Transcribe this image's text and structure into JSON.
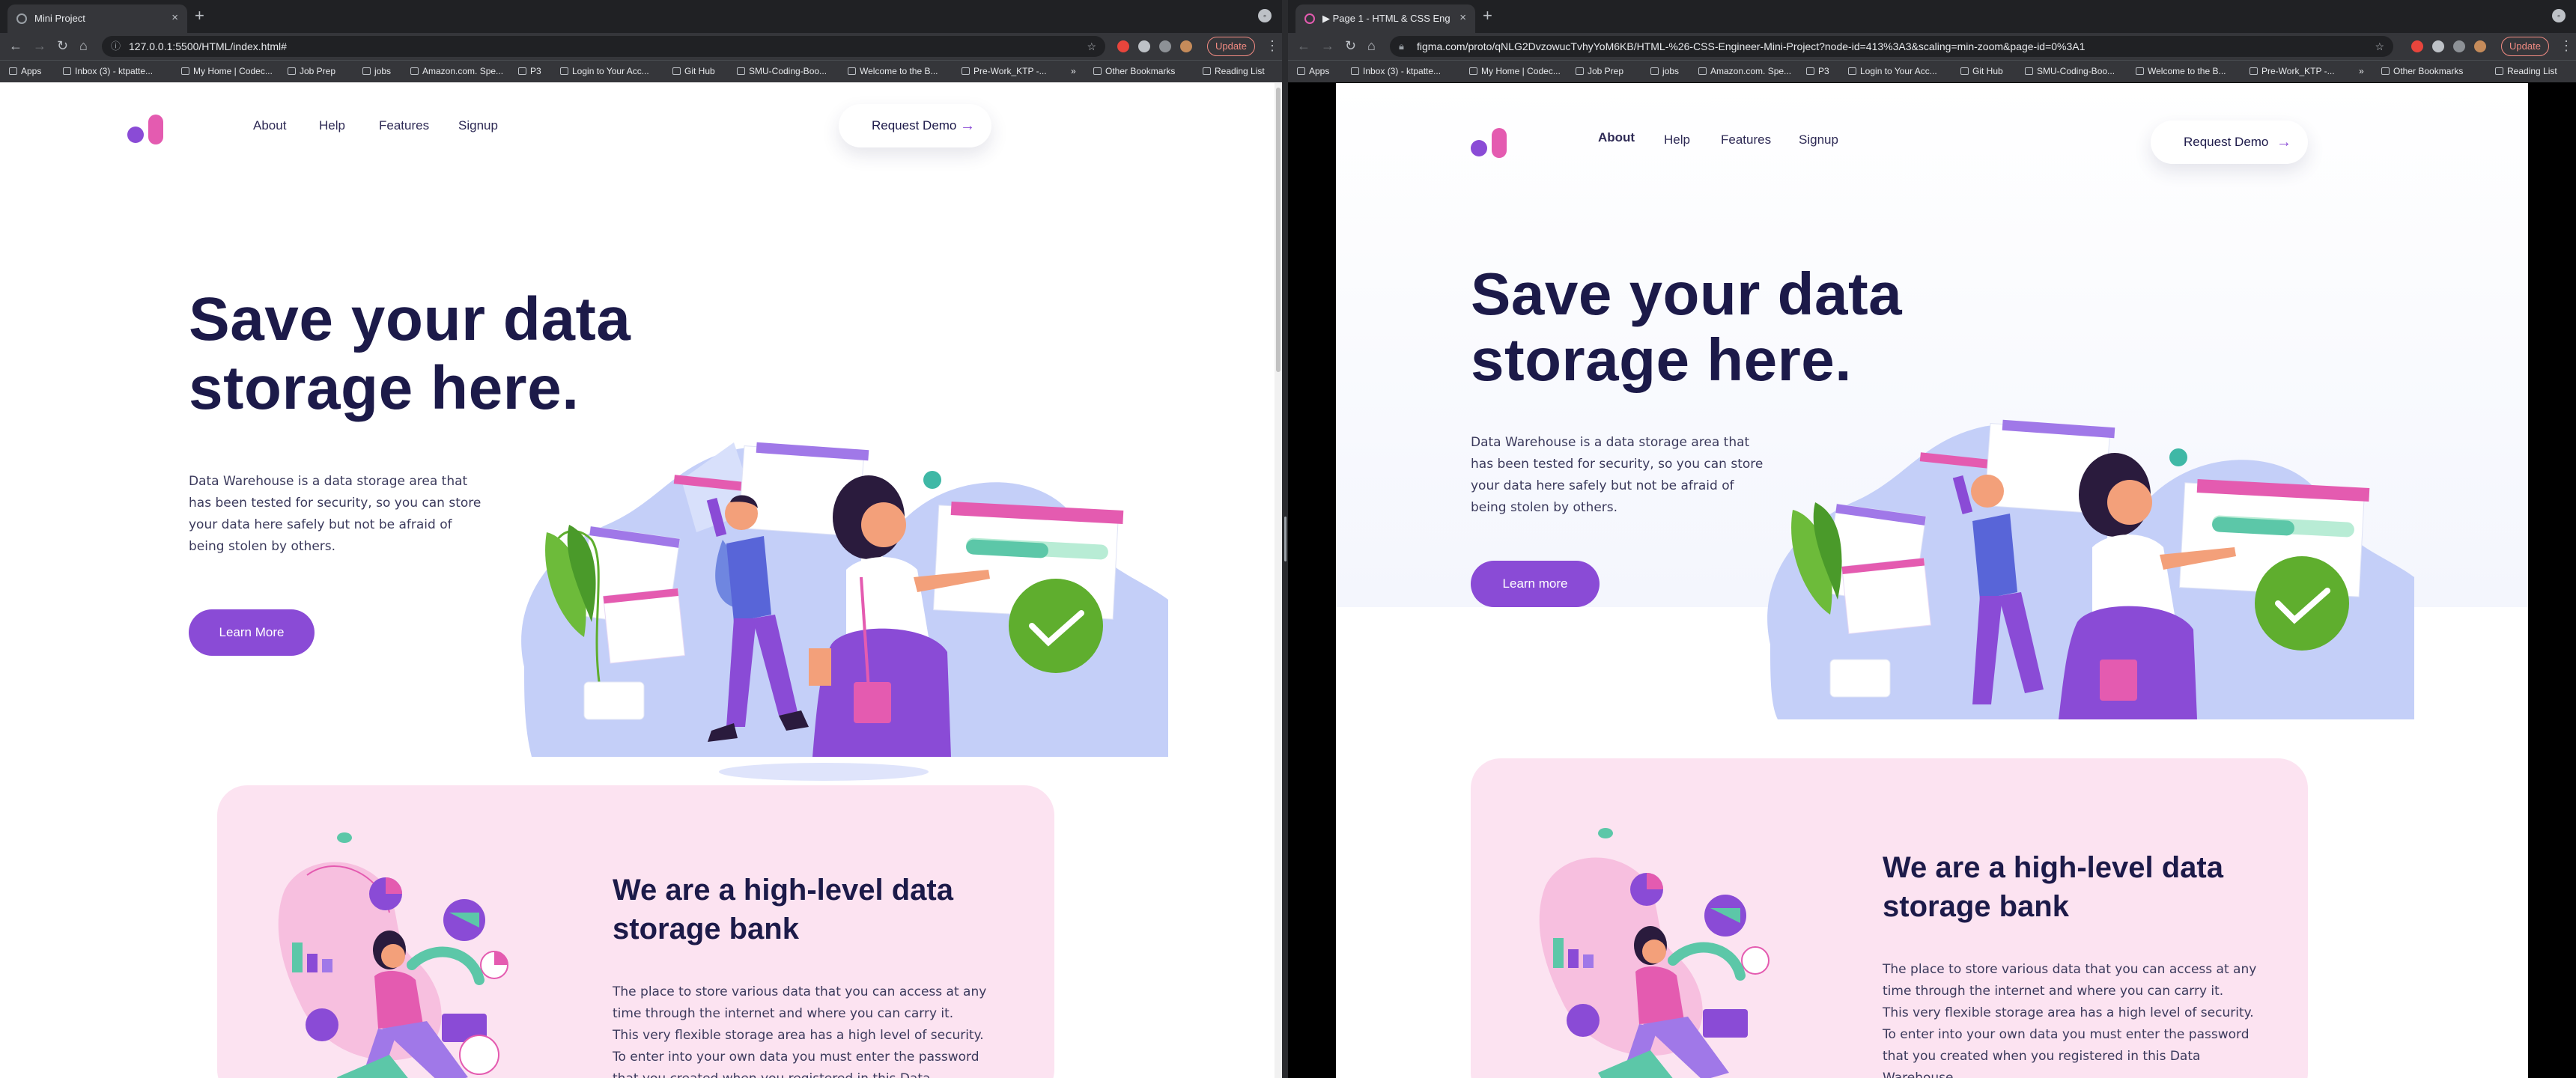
{
  "left": {
    "tab_title": "Mini Project",
    "url": "127.0.0.1:5500/HTML/index.html#",
    "update_label": "Update",
    "bookmarks": [
      "Apps",
      "Inbox (3) - ktpatte...",
      "My Home | Codec...",
      "Job Prep",
      "jobs",
      "Amazon.com. Spe...",
      "P3",
      "Login to Your Acc...",
      "Git Hub",
      "SMU-Coding-Boo...",
      "Welcome to the B...",
      "Pre-Work_KTP -...",
      "»",
      "Other Bookmarks",
      "Reading List"
    ],
    "nav": [
      "About",
      "Help",
      "Features",
      "Signup"
    ],
    "demo_label": "Request Demo",
    "hero_title": [
      "Save your data",
      "storage here."
    ],
    "hero_text": [
      "Data Warehouse is a data storage area that",
      "has been tested for security, so you can store",
      "your data here safely but not be afraid of",
      "being stolen by others."
    ],
    "cta_label": "Learn More",
    "section_title": [
      "We are a high-level data",
      "storage bank"
    ],
    "section_text": [
      "The place to store various data that you can access at any",
      "time through the internet and where you can carry it.",
      "This very flexible storage area has a high level of security.",
      "To enter into your own data you must enter the password",
      "that you created when you registered in this Data"
    ]
  },
  "right": {
    "tab_title": "▶ Page 1 - HTML & CSS Engi...",
    "url": "figma.com/proto/qNLG2DvzowucTvhyYoM6KB/HTML-%26-CSS-Engineer-Mini-Project?node-id=413%3A3&scaling=min-zoom&page-id=0%3A1",
    "update_label": "Update",
    "bookmarks": [
      "Apps",
      "Inbox (3) - ktpatte...",
      "My Home | Codec...",
      "Job Prep",
      "jobs",
      "Amazon.com. Spe...",
      "P3",
      "Login to Your Acc...",
      "Git Hub",
      "SMU-Coding-Boo...",
      "Welcome to the B...",
      "Pre-Work_KTP -...",
      "»",
      "Other Bookmarks",
      "Reading List"
    ],
    "nav": [
      "About",
      "Help",
      "Features",
      "Signup"
    ],
    "demo_label": "Request Demo",
    "hero_title": [
      "Save your data",
      "storage here."
    ],
    "hero_text": [
      "Data Warehouse is a data storage area that",
      "has been  tested for security, so you can store",
      "your data here  safely but not be afraid of",
      "being stolen by others."
    ],
    "cta_label": "Learn more",
    "section_title": [
      "We are a high-level data",
      "storage bank"
    ],
    "section_text": [
      "The place to store various data that you can access at any",
      "time through the internet  and where you can carry it.",
      "This very flexible storage area has a high level of security.",
      "To enter into your own data you must enter the password",
      "that you created when you registered in this Data",
      "Warehouse."
    ]
  },
  "colors": {
    "accent": "#8a4bd6",
    "pink": "#e45bb0",
    "navy": "#1c1a49",
    "card": "#fce3f1",
    "blob": "#c4cff8",
    "green": "#5fae2e"
  }
}
